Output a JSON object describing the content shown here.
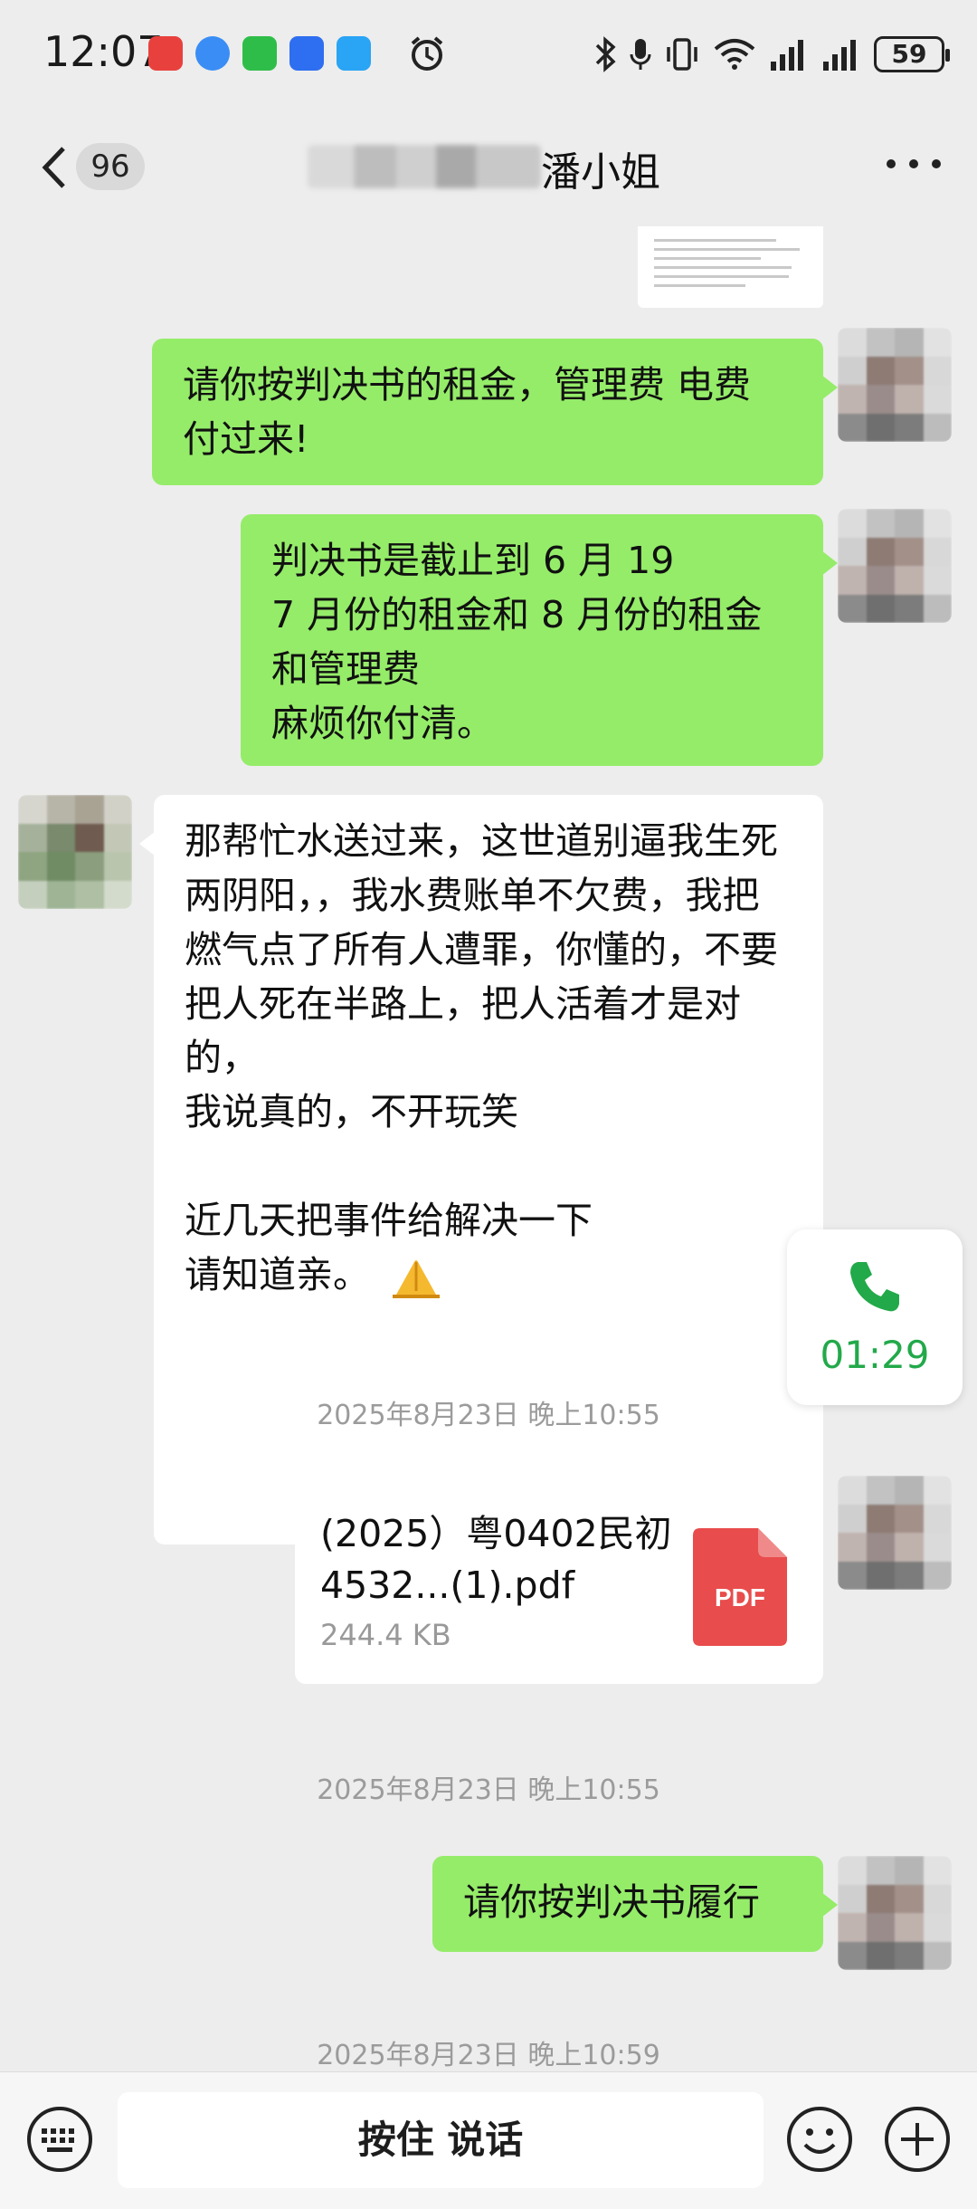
{
  "status_bar": {
    "time": "12:07",
    "battery": "59",
    "app_icons": [
      "huawei-store-icon",
      "qq-browser-icon",
      "wechat-icon",
      "voice-recorder-icon",
      "message-icon"
    ],
    "system_icons": [
      "alarm-icon",
      "bluetooth-icon",
      "mic-icon",
      "vibrate-icon",
      "wifi-icon",
      "signal-icon",
      "signal-icon",
      "battery-icon"
    ]
  },
  "header": {
    "unread_count": "96",
    "contact_name": "潘小姐"
  },
  "messages": [
    {
      "id": "m1",
      "direction": "out",
      "text": "请你按判决书的租金，管理费 电费  付过来!"
    },
    {
      "id": "m2",
      "direction": "out",
      "text": "判决书是截止到 6 月 19\n7 月份的租金和 8 月份的租金和管理费\n麻烦你付清。"
    },
    {
      "id": "m3",
      "direction": "in",
      "text": "那帮忙水送过来，这世道别逼我生死两阴阳，，我水费账单不欠费，我把燃气点了所有人遭罪，你懂的，不要把人死在半路上，把人活着才是对的，\n我说真的，不开玩笑\n\n近几天把事件给解决一下\n请知道亲。"
    }
  ],
  "call": {
    "duration": "01:29",
    "color": "#22a94a"
  },
  "timestamps": [
    "2025年8月23日 晚上10:55",
    "2025年8月23日 晚上10:55",
    "2025年8月23日 晚上10:59"
  ],
  "file": {
    "name": "(2025）粤0402民初4532...(1).pdf",
    "size": "244.4 KB",
    "icon_label": "PDF",
    "icon_color": "#e84c4c"
  },
  "last_message": {
    "direction": "out",
    "text": "请你按判决书履行"
  },
  "input_bar": {
    "hold_to_talk": "按住 说话"
  },
  "colors": {
    "bubble_out": "#95ec69",
    "bubble_in": "#ffffff",
    "background": "#ededed"
  }
}
